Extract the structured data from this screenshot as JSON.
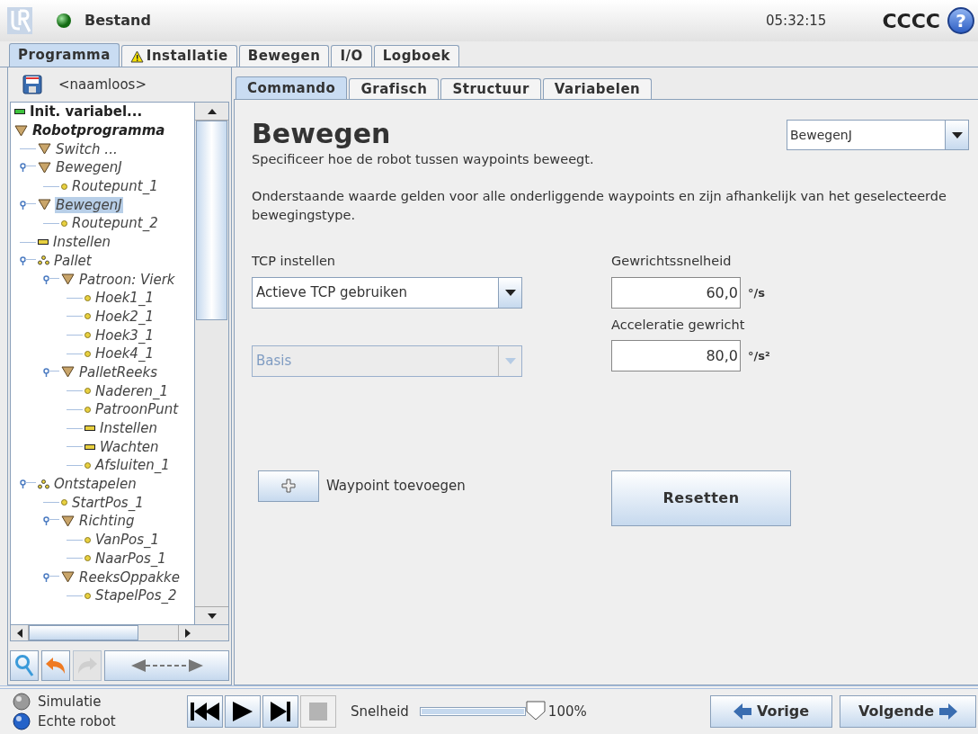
{
  "header": {
    "menu": "Bestand",
    "time": "05:32:15",
    "robot_name": "CCCC",
    "help": "?"
  },
  "main_tabs": [
    {
      "label": "Programma",
      "selected": true,
      "warning": false
    },
    {
      "label": "Installatie",
      "selected": false,
      "warning": true
    },
    {
      "label": "Bewegen",
      "selected": false,
      "warning": false
    },
    {
      "label": "I/O",
      "selected": false,
      "warning": false
    },
    {
      "label": "Logboek",
      "selected": false,
      "warning": false
    }
  ],
  "program_name": "<naamloos>",
  "tree": [
    {
      "label": "Init. variabel...",
      "kind": "init",
      "selected": false
    },
    {
      "label": "Robotprogramma",
      "kind": "root",
      "selected": false,
      "children": [
        {
          "label": "Switch ...",
          "kind": "folder",
          "selected": false
        },
        {
          "label": "BewegenJ",
          "kind": "folder",
          "selected": false,
          "children": [
            {
              "label": "Routepunt_1",
              "kind": "point",
              "selected": false
            }
          ]
        },
        {
          "label": "BewegenJ",
          "kind": "folder",
          "selected": true,
          "children": [
            {
              "label": "Routepunt_2",
              "kind": "point",
              "selected": false
            }
          ]
        },
        {
          "label": "Instellen",
          "kind": "action",
          "selected": false
        },
        {
          "label": "Pallet",
          "kind": "pallet",
          "selected": false,
          "children": [
            {
              "label": "Patroon: Vierk",
              "kind": "folder",
              "selected": false,
              "children": [
                {
                  "label": "Hoek1_1",
                  "kind": "point",
                  "selected": false
                },
                {
                  "label": "Hoek2_1",
                  "kind": "point",
                  "selected": false
                },
                {
                  "label": "Hoek3_1",
                  "kind": "point",
                  "selected": false
                },
                {
                  "label": "Hoek4_1",
                  "kind": "point",
                  "selected": false
                }
              ]
            },
            {
              "label": "PalletReeks",
              "kind": "folder",
              "selected": false,
              "children": [
                {
                  "label": "Naderen_1",
                  "kind": "point",
                  "selected": false
                },
                {
                  "label": "PatroonPunt",
                  "kind": "point",
                  "selected": false
                },
                {
                  "label": "Instellen",
                  "kind": "action",
                  "selected": false
                },
                {
                  "label": "Wachten",
                  "kind": "action",
                  "selected": false
                },
                {
                  "label": "Afsluiten_1",
                  "kind": "point",
                  "selected": false
                }
              ]
            }
          ]
        },
        {
          "label": "Ontstapelen",
          "kind": "pallet",
          "selected": false,
          "children": [
            {
              "label": "StartPos_1",
              "kind": "point",
              "selected": false
            },
            {
              "label": "Richting",
              "kind": "folder",
              "selected": false,
              "children": [
                {
                  "label": "VanPos_1",
                  "kind": "point",
                  "selected": false
                },
                {
                  "label": "NaarPos_1",
                  "kind": "point",
                  "selected": false
                }
              ]
            },
            {
              "label": "ReeksOppakke",
              "kind": "folder",
              "selected": false,
              "children": [
                {
                  "label": "StapelPos_2",
                  "kind": "point",
                  "selected": false
                }
              ]
            }
          ]
        }
      ]
    }
  ],
  "sub_tabs": [
    {
      "label": "Commando",
      "selected": true
    },
    {
      "label": "Grafisch",
      "selected": false
    },
    {
      "label": "Structuur",
      "selected": false
    },
    {
      "label": "Variabelen",
      "selected": false
    }
  ],
  "command": {
    "title": "Bewegen",
    "move_type": "BewegenJ",
    "subtitle": "Specificeer hoe de robot tussen waypoints beweegt.",
    "description": "Onderstaande waarde gelden voor alle onderliggende waypoints en zijn afhankelijk van het geselecteerde bewegingstype.",
    "tcp_label": "TCP instellen",
    "tcp_value": "Actieve TCP gebruiken",
    "feature_value": "Basis",
    "feature_disabled": true,
    "speed_label": "Gewrichtssnelheid",
    "speed_value": "60,0",
    "speed_unit": "°/s",
    "accel_label": "Acceleratie gewricht",
    "accel_value": "80,0",
    "accel_unit": "°/s²",
    "add_waypoint": "Waypoint toevoegen",
    "reset": "Resetten"
  },
  "footer": {
    "modes": [
      {
        "label": "Simulatie",
        "selected": false
      },
      {
        "label": "Echte robot",
        "selected": true
      }
    ],
    "speed_label": "Snelheid",
    "speed": {
      "level": 1.0
    },
    "speed_reading": "100%",
    "prev": "Vorige",
    "next": "Volgende"
  }
}
